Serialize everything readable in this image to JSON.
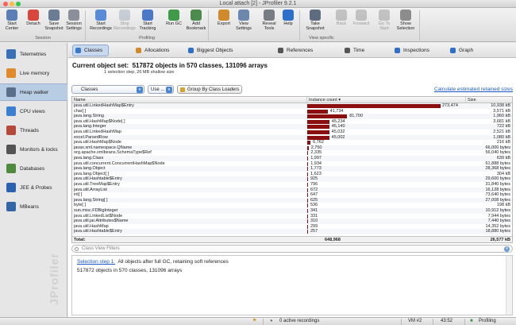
{
  "window": {
    "title": "Local attach [2] - JProfiler 9.2.1"
  },
  "toolbar": {
    "buttons": [
      {
        "label": "Start\nCenter",
        "icon": "start-center-icon",
        "color": "#5b7fb5",
        "enabled": true
      },
      {
        "label": "Detach",
        "icon": "detach-icon",
        "color": "#d9463c",
        "enabled": true
      },
      {
        "label": "Save\nSnapshot",
        "icon": "save-snapshot-icon",
        "color": "#6b7d95",
        "enabled": true
      },
      {
        "label": "Session\nSettings",
        "icon": "session-settings-icon",
        "color": "#8a8f9a",
        "enabled": true
      },
      {
        "label": "Start\nRecordings",
        "icon": "start-recordings-icon",
        "color": "#5a8bd6",
        "enabled": true
      },
      {
        "label": "Stop\nRecordings",
        "icon": "stop-recordings-icon",
        "color": "#9aa7b7",
        "enabled": false
      },
      {
        "label": "Start\nTracking",
        "icon": "start-tracking-icon",
        "color": "#4c78c8",
        "enabled": true
      },
      {
        "label": "Run GC",
        "icon": "run-gc-icon",
        "color": "#3f9a4a",
        "enabled": true
      },
      {
        "label": "Add\nBookmark",
        "icon": "add-bookmark-icon",
        "color": "#4d8a4d",
        "enabled": true
      },
      {
        "label": "Export",
        "icon": "export-icon",
        "color": "#d08a2c",
        "enabled": true
      },
      {
        "label": "View\nSettings",
        "icon": "view-settings-icon",
        "color": "#6d87ad",
        "enabled": true
      },
      {
        "label": "Reveal\nTools",
        "icon": "reveal-tools-icon",
        "color": "#777c85",
        "enabled": true
      },
      {
        "label": "Help",
        "icon": "help-icon",
        "color": "#2f6fcc",
        "enabled": true
      },
      {
        "label": "Take\nSnapshot",
        "icon": "take-snapshot-icon",
        "color": "#5e6c80",
        "enabled": true
      },
      {
        "label": "Back",
        "icon": "back-icon",
        "color": "#8c8c8c",
        "enabled": false
      },
      {
        "label": "Forward",
        "icon": "forward-icon",
        "color": "#8c8c8c",
        "enabled": false
      },
      {
        "label": "Go To\nStart",
        "icon": "go-to-start-icon",
        "color": "#8c8c8c",
        "enabled": false
      },
      {
        "label": "Show\nSelection",
        "icon": "show-selection-icon",
        "color": "#8c8c8c",
        "enabled": true
      }
    ],
    "groups": {
      "session": "Session",
      "profiling": "Profiling",
      "view_specific": "View specific"
    }
  },
  "sidebar": {
    "items": [
      {
        "label": "Telemetries",
        "icon": "telemetries-icon",
        "color": "#3b6fb6"
      },
      {
        "label": "Live memory",
        "icon": "live-memory-icon",
        "color": "#e08a2e"
      },
      {
        "label": "Heap walker",
        "icon": "heap-walker-icon",
        "color": "#5a6f8c"
      },
      {
        "label": "CPU views",
        "icon": "cpu-views-icon",
        "color": "#3c7fcf"
      },
      {
        "label": "Threads",
        "icon": "threads-icon",
        "color": "#b34a3b"
      },
      {
        "label": "Monitors & locks",
        "icon": "monitors-locks-icon",
        "color": "#545454"
      },
      {
        "label": "Databases",
        "icon": "databases-icon",
        "color": "#4f8a3f"
      },
      {
        "label": "JEE & Probes",
        "icon": "jee-probes-icon",
        "color": "#2b62b0"
      },
      {
        "label": "MBeans",
        "icon": "mbeans-icon",
        "color": "#3465a4"
      }
    ],
    "active": "Heap walker",
    "watermark": "JProfiler"
  },
  "subtabs": [
    {
      "label": "Classes",
      "color": "#3a79c9"
    },
    {
      "label": "Allocations",
      "color": "#d08a2c"
    },
    {
      "label": "Biggest Objects",
      "color": "#2f6fcc"
    },
    {
      "label": "References",
      "color": "#555555"
    },
    {
      "label": "Time",
      "color": "#555555"
    },
    {
      "label": "Inspections",
      "color": "#2f6fcc"
    },
    {
      "label": "Graph",
      "color": "#2f6fcc"
    }
  ],
  "header": {
    "title_prefix": "Current object set:",
    "title_value": "517872 objects in 570 classes, 131096 arrays",
    "subtitle": "1 selection step, 26 MB shallow size"
  },
  "controls": {
    "view_select": "Classes",
    "use_select": "Use ...",
    "group_button": "Group By Class Loaders",
    "calc_link": "Calculate estimated retained sizes"
  },
  "table": {
    "columns": {
      "name": "Name",
      "count": "Instance count",
      "size": "Size"
    },
    "max_count": 273474,
    "rows": [
      {
        "name": "java.util.LinkedHashMap$Entry",
        "count": 273474,
        "count_label": "273,474",
        "size": "10,938 kB"
      },
      {
        "name": "char[ ]",
        "count": 41734,
        "count_label": "41,734",
        "size": "3,571 kB"
      },
      {
        "name": "java.lang.String",
        "count": 81700,
        "count_label": "81,700",
        "size": "1,960 kB"
      },
      {
        "name": "java.util.HashMap$Node[ ]",
        "count": 45234,
        "count_label": "45,234",
        "size": "3,681 kB"
      },
      {
        "name": "java.lang.Integer",
        "count": 45140,
        "count_label": "45,140",
        "size": "722 kB"
      },
      {
        "name": "java.util.LinkedHashMap",
        "count": 45032,
        "count_label": "45,032",
        "size": "2,521 kB"
      },
      {
        "name": "excel.ParsedRow",
        "count": 45002,
        "count_label": "45,002",
        "size": "1,080 kB"
      },
      {
        "name": "java.util.HashMap$Node",
        "count": 6762,
        "count_label": "6,762",
        "size": "216 kB"
      },
      {
        "name": "javax.xml.namespace.QName",
        "count": 2750,
        "count_label": "2,750",
        "size": "66,000 bytes"
      },
      {
        "name": "org.apache.xmlbeans.SchemaType$Ref",
        "count": 2335,
        "count_label": "2,335",
        "size": "56,040 bytes"
      },
      {
        "name": "java.lang.Class",
        "count": 1997,
        "count_label": "1,997",
        "size": "639 kB"
      },
      {
        "name": "java.util.concurrent.ConcurrentHashMap$Node",
        "count": 1934,
        "count_label": "1,934",
        "size": "61,888 bytes"
      },
      {
        "name": "java.lang.Object",
        "count": 1773,
        "count_label": "1,773",
        "size": "28,368 bytes"
      },
      {
        "name": "java.lang.Object[ ]",
        "count": 1623,
        "count_label": "1,623",
        "size": "304 kB"
      },
      {
        "name": "java.util.Hashtable$Entry",
        "count": 925,
        "count_label": "925",
        "size": "29,600 bytes"
      },
      {
        "name": "java.util.TreeMap$Entry",
        "count": 796,
        "count_label": "796",
        "size": "31,840 bytes"
      },
      {
        "name": "java.util.ArrayList",
        "count": 672,
        "count_label": "672",
        "size": "16,128 bytes"
      },
      {
        "name": "int[ ]",
        "count": 647,
        "count_label": "647",
        "size": "73,640 bytes"
      },
      {
        "name": "java.lang.String[ ]",
        "count": 625,
        "count_label": "625",
        "size": "27,008 bytes"
      },
      {
        "name": "byte[ ]",
        "count": 536,
        "count_label": "536",
        "size": "198 kB"
      },
      {
        "name": "sun.misc.FDBigInteger",
        "count": 341,
        "count_label": "341",
        "size": "10,912 bytes"
      },
      {
        "name": "java.util.LinkedList$Node",
        "count": 331,
        "count_label": "331",
        "size": "7,944 bytes"
      },
      {
        "name": "java.util.jar.Attributes$Name",
        "count": 310,
        "count_label": "310",
        "size": "7,440 bytes"
      },
      {
        "name": "java.util.HashMap",
        "count": 299,
        "count_label": "299",
        "size": "14,352 bytes"
      },
      {
        "name": "java.util.Hashtable$Entry",
        "count": 257,
        "count_label": "257",
        "size": "18,880 bytes"
      }
    ],
    "total": {
      "label": "Total:",
      "count": "648,968",
      "size": "26,577 kB"
    }
  },
  "filter": {
    "placeholder": "Class View Filters"
  },
  "info": {
    "link": "Selection step 1:",
    "line1": "All objects after full GC, retaining soft references",
    "line2": "517872 objects in 570 classes, 131096 arrays"
  },
  "status": {
    "recordings": "0 active recordings",
    "vm": "VM #2",
    "time": "43:52",
    "state": "Profiling"
  }
}
